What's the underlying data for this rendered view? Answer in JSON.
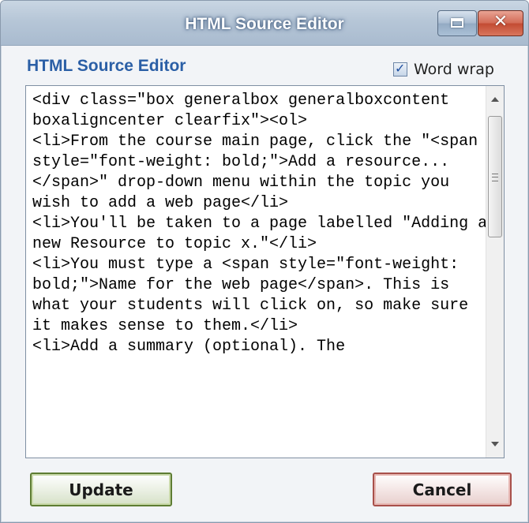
{
  "window": {
    "title": "HTML Source Editor"
  },
  "dialog": {
    "heading": "HTML Source Editor",
    "word_wrap_label": "Word wrap",
    "word_wrap_checked": true,
    "source_code": "<div class=\"box generalbox generalboxcontent boxaligncenter clearfix\"><ol>\n<li>From the course main page, click the \"<span style=\"font-weight: bold;\">Add a resource...</span>\" drop-down menu within the topic you wish to add a web page</li>\n<li>You'll be taken to a page labelled \"Adding a new Resource to topic x.\"</li>\n<li>You must type a <span style=\"font-weight: bold;\">Name for the web page</span>. This is what your students will click on, so make sure it makes sense to them.</li>\n<li>Add a summary (optional). The"
  },
  "buttons": {
    "update_label": "Update",
    "cancel_label": "Cancel"
  },
  "colors": {
    "heading": "#2b5fa6",
    "titlebar": "#b6c6d7",
    "close_button": "#c24a32"
  }
}
